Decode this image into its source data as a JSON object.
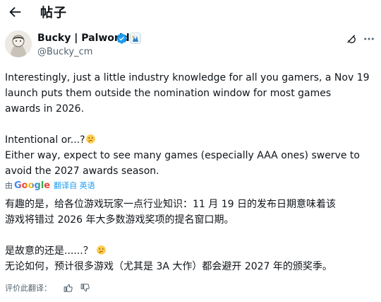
{
  "header": {
    "title": "帖子"
  },
  "author": {
    "display_name": "Bucky | Palworld",
    "handle": "@Bucky_cm"
  },
  "tweet": {
    "original_text": "Interestingly, just a little industry knowledge for all you gamers, a Nov 19\nlaunch puts them outside the nomination window for most games\nawards in 2026.\n\nIntentional or...?",
    "original_text_2": "Either way, expect to see many games (especially AAA ones) swerve to\navoid the 2027 awards season.",
    "translated_text": "有趣的是，给各位游戏玩家一点行业知识：11 月 19 日的发布日期意味着该\n游戏将错过 2026 年大多数游戏奖项的提名窗口期。\n\n是故意的还是......？",
    "translated_text_2": "无论如何，预计很多游戏（尤其是 3A 大作）都会避开 2027 年的颁奖季。"
  },
  "translation": {
    "by_label": "由",
    "provider": "Google",
    "action_label": "翻译自 英语",
    "rate_label": "评价此翻译："
  },
  "icons": {
    "back": "arrow-left-icon",
    "verified": "verified-badge-icon",
    "affiliate": "affiliate-badge-icon",
    "grok": "grok-icon",
    "more": "more-horizontal-icon",
    "emoji": "thinking-face-emoji-icon",
    "thumbs_up": "thumbs-up-icon",
    "thumbs_down": "thumbs-down-icon"
  },
  "colors": {
    "text": "#0f1419",
    "secondary": "#536471",
    "link": "#1d9bf0",
    "verified": "#1d9bf0"
  }
}
